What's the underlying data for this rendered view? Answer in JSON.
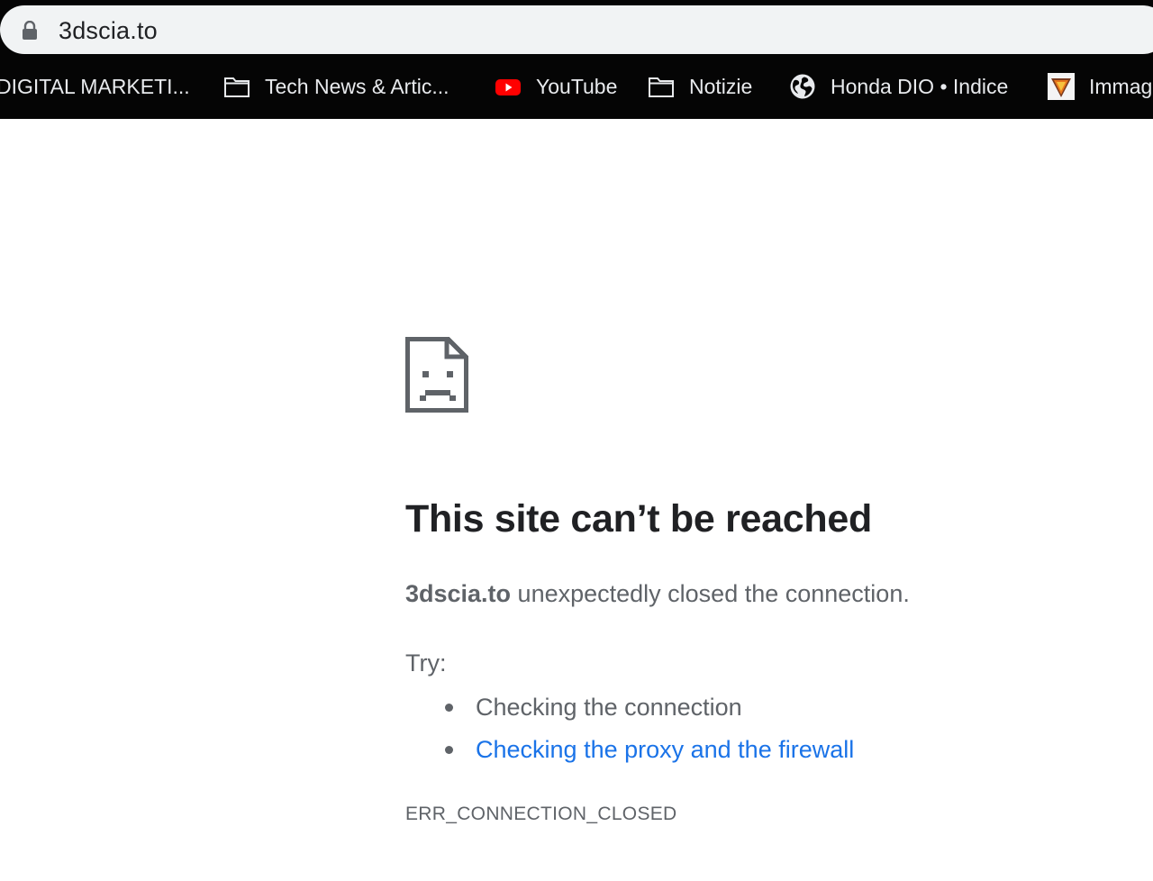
{
  "browser": {
    "url": "3dscia.to",
    "bookmarks": [
      {
        "label": "DIGITAL MARKETI...",
        "icon": "none"
      },
      {
        "label": "Tech News & Artic...",
        "icon": "folder-icon"
      },
      {
        "label": "YouTube",
        "icon": "youtube-icon"
      },
      {
        "label": "Notizie",
        "icon": "folder-icon"
      },
      {
        "label": "Honda DIO • Indice",
        "icon": "globe-icon"
      },
      {
        "label": "Immag",
        "icon": "site-favicon-icon"
      }
    ]
  },
  "error_page": {
    "icon": "sad-page-icon",
    "title": "This site can’t be reached",
    "host": "3dscia.to",
    "message_rest": " unexpectedly closed the connection.",
    "try_label": "Try:",
    "suggestions": [
      {
        "label": "Checking the connection",
        "link": false
      },
      {
        "label": "Checking the proxy and the firewall",
        "link": true
      }
    ],
    "error_code": "ERR_CONNECTION_CLOSED"
  },
  "colors": {
    "chrome_background": "#050505",
    "omnibox_background": "#f1f3f4",
    "text_primary": "#202124",
    "text_secondary": "#5f6368",
    "link": "#1a73e8",
    "youtube_red": "#ff0000"
  }
}
